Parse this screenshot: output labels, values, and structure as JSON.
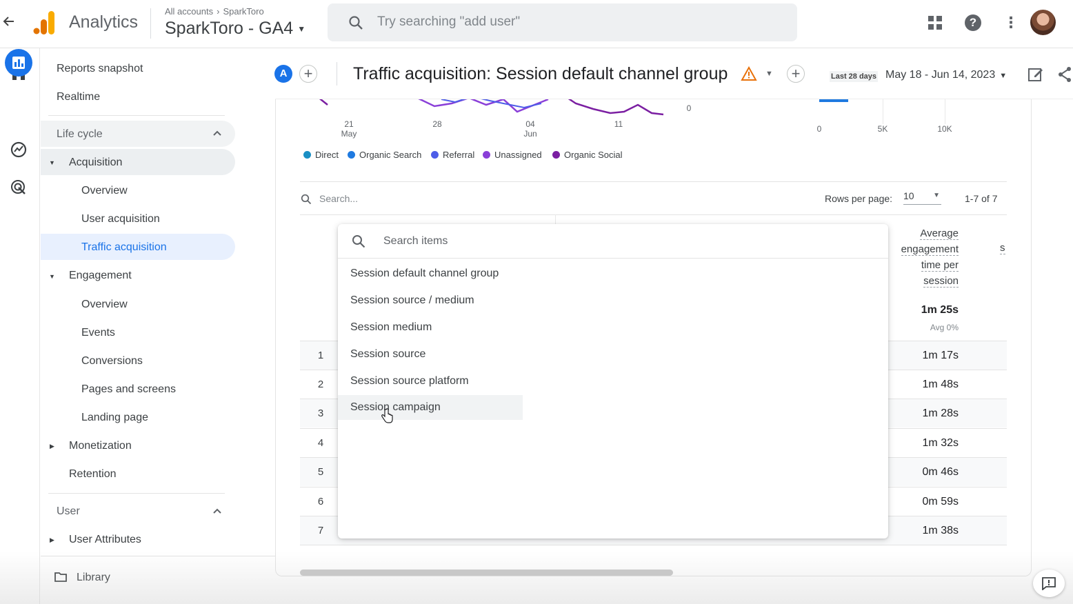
{
  "topbar": {
    "app_name": "Analytics",
    "breadcrumb": [
      "All accounts",
      "SparkToro"
    ],
    "property": "SparkToro - GA4",
    "search_placeholder": "Try searching \"add user\""
  },
  "rail": {
    "icons": [
      "home-icon",
      "reports-icon",
      "explore-icon",
      "advertising-icon"
    ]
  },
  "nav": {
    "top_items": [
      "Reports snapshot",
      "Realtime"
    ],
    "lifecycle_label": "Life cycle",
    "acquisition_label": "Acquisition",
    "acquisition_items": [
      "Overview",
      "User acquisition",
      "Traffic acquisition"
    ],
    "engagement_label": "Engagement",
    "engagement_items": [
      "Overview",
      "Events",
      "Conversions",
      "Pages and screens",
      "Landing page"
    ],
    "monetization_label": "Monetization",
    "retention_label": "Retention",
    "user_label": "User",
    "user_attributes_label": "User Attributes",
    "library_label": "Library"
  },
  "report": {
    "compare_chip": "A",
    "title": "Traffic acquisition: Session default channel group",
    "range_label": "Last 28 days",
    "date_range": "May 18 - Jun 14, 2023"
  },
  "chart": {
    "x_ticks": [
      {
        "d": "21",
        "m": "May"
      },
      {
        "d": "28",
        "m": ""
      },
      {
        "d": "04",
        "m": "Jun"
      },
      {
        "d": "11",
        "m": ""
      }
    ],
    "y_zero": "0",
    "bar_ticks": [
      "0",
      "5K",
      "10K"
    ],
    "legend": [
      {
        "label": "Direct",
        "color": "#1a8fc4"
      },
      {
        "label": "Organic Search",
        "color": "#1f7ae0"
      },
      {
        "label": "Referral",
        "color": "#4d5de8"
      },
      {
        "label": "Unassigned",
        "color": "#8a3fd8"
      },
      {
        "label": "Organic Social",
        "color": "#7b1fa2"
      }
    ]
  },
  "table": {
    "search_placeholder": "Search...",
    "rows_per_page_label": "Rows per page:",
    "rows_per_page": "10",
    "page_count": "1-7 of 7",
    "column_header_lines": [
      "Average",
      "engagement",
      "time per",
      "session"
    ],
    "column_header_next": "s",
    "total_value": "1m 25s",
    "total_sub": "Avg 0%",
    "rows": [
      {
        "n": "1",
        "value": "1m 17s"
      },
      {
        "n": "2",
        "value": "1m 48s"
      },
      {
        "n": "3",
        "value": "1m 28s"
      },
      {
        "n": "4",
        "value": "1m 32s"
      },
      {
        "n": "5",
        "value": "0m 46s"
      },
      {
        "n": "6",
        "value": "0m 59s"
      },
      {
        "n": "7",
        "value": "1m 38s"
      }
    ]
  },
  "dropdown": {
    "search_placeholder": "Search items",
    "items": [
      "Session default channel group",
      "Session source / medium",
      "Session medium",
      "Session source",
      "Session source platform",
      "Session campaign"
    ],
    "hovered": "Session campaign"
  }
}
